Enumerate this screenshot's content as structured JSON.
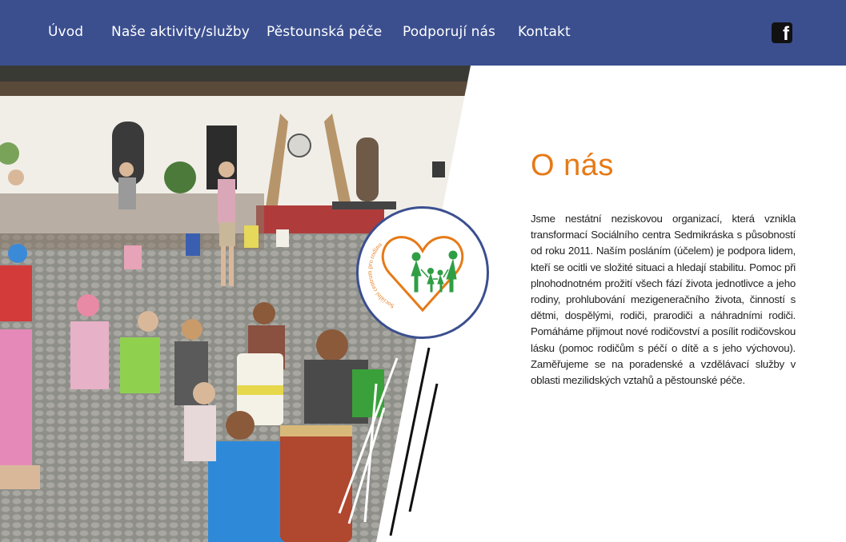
{
  "nav": {
    "items": [
      {
        "label": "Úvod"
      },
      {
        "label": "Naše aktivity/služby"
      },
      {
        "label": "Pěstounská péče"
      },
      {
        "label": "Podporují nás"
      },
      {
        "label": "Kontakt"
      }
    ],
    "social_icon": "facebook-icon"
  },
  "hero": {
    "photo": "children-drumming-workshop-photo",
    "logo": {
      "arc_text": "Sociální centrum pro rodinu",
      "icon": "heart-family-logo"
    }
  },
  "about": {
    "title": "O nás",
    "text": "Jsme nestátní neziskovou organizací, která vznikla transformací Sociálního centra Sedmikráska s působností od roku 2011. Naším posláním (účelem) je podpora lidem, kteří se ocitli ve složité situaci a hledají stabilitu. Pomoc při plnohodnotném prožití všech fází života jednotlivce a jeho rodiny, prohlubování mezigeneračního života, činností s dětmi, dospělými, rodiči, prarodiči a náhradními rodiči. Pomáháme přijmout nové rodičovství a posílit rodičovskou lásku (pomoc rodičům s péčí o dítě a s jeho výchovou). Zaměřujeme se na poradenské a vzdělávací služby v oblasti mezilidských vztahů a pěstounské péče."
  },
  "colors": {
    "nav_bg": "#3b4f8f",
    "accent": "#e67a17",
    "logo_green": "#2f9e44"
  }
}
